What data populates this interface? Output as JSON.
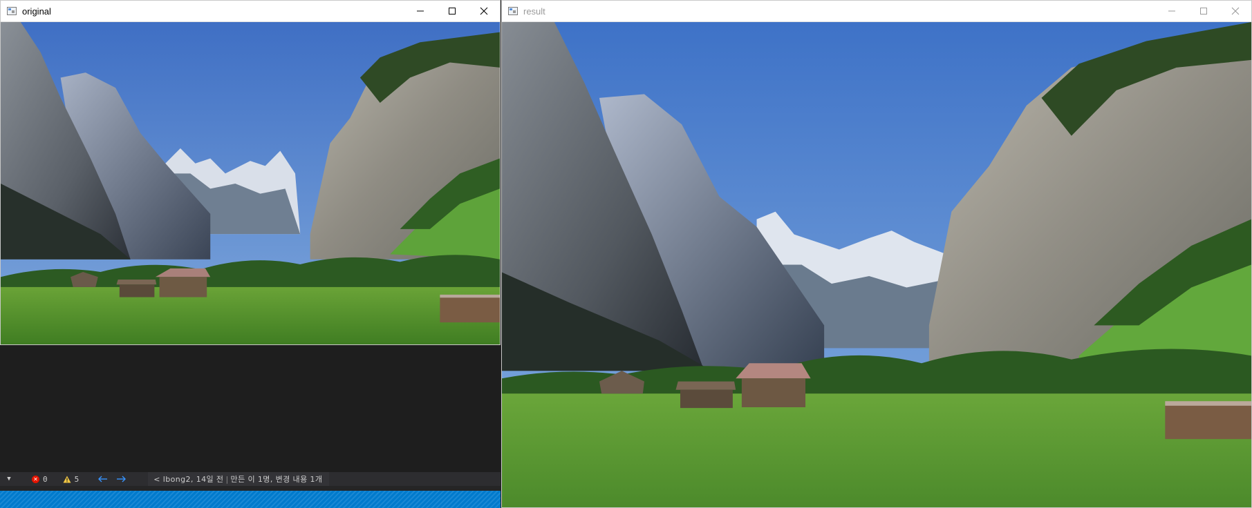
{
  "windows": {
    "original": {
      "title": "original"
    },
    "result": {
      "title": "result"
    }
  },
  "icons": {
    "app": "app-window-icon",
    "minimize": "minimize-icon",
    "maximize": "maximize-icon",
    "close": "close-icon",
    "error": "error-circle-icon",
    "warning": "warning-triangle-icon",
    "back": "arrow-left-icon",
    "forward": "arrow-right-icon",
    "dropdown": "chevron-down-icon"
  },
  "statusbar": {
    "errors_count": "0",
    "warnings_count": "5",
    "blame_prefix": "<",
    "blame_author_time": "lbong2, 14일 전",
    "blame_separator": "|",
    "blame_summary": "만든 이 1명, 변경 내용 1개"
  },
  "colors": {
    "editor_bg": "#1e1e1e",
    "statusbar_bg": "#2d2d30",
    "accent_blue": "#007acc",
    "error_red": "#e51400",
    "warning_yellow": "#f2c744",
    "nav_arrow_blue": "#3794ff"
  }
}
